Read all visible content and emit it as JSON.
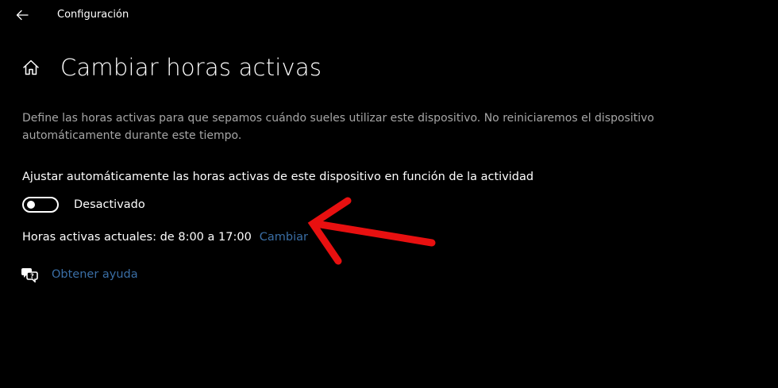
{
  "window": {
    "app_title": "Configuración"
  },
  "header": {
    "title": "Cambiar horas activas"
  },
  "description": "Define las horas activas para que sepamos cuándo sueles utilizar este dispositivo. No reiniciaremos el dispositivo automáticamente durante este tiempo.",
  "auto_adjust": {
    "label": "Ajustar automáticamente las horas activas de este dispositivo en función de la actividad",
    "toggle_state": "Desactivado",
    "toggle_on": false
  },
  "active_hours": {
    "text": "Horas activas actuales: de 8:00 a 17:00",
    "change_link": "Cambiar"
  },
  "help": {
    "link": "Obtener ayuda"
  },
  "colors": {
    "background": "#000000",
    "text": "#ffffff",
    "secondary_text": "#a6a6a6",
    "link": "#3a6ea5",
    "annotation_arrow": "#e81010"
  },
  "icons": {
    "back": "arrow-left-icon",
    "home": "home-icon",
    "help": "chat-help-icon"
  }
}
